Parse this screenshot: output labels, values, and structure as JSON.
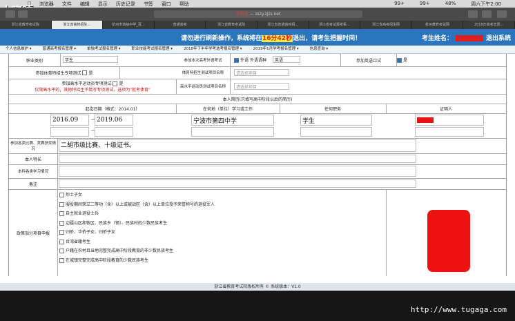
{
  "menubar": {
    "app": "浏览器",
    "items": [
      "文件",
      "编辑",
      "显示",
      "历史记录",
      "书签",
      "窗口",
      "帮助"
    ],
    "right": [
      "99+",
      "99+",
      "48%",
      "周六下午2:00"
    ]
  },
  "overlay_logo": "上嗜嘎",
  "url": {
    "red_part": "不安全",
    "text": " — zszy.zjzs.net"
  },
  "tabs": [
    "浙江省教育考试院",
    "浙江省高校招生...",
    "杭州市高级中学_百...",
    "普通高考",
    "浙江省教育考试院",
    "浙江省普通高校招...",
    "浙江省考试报考系...",
    "浙江省高考招生网",
    "杭州教育考试网",
    "2018年高考志愿..."
  ],
  "banner": {
    "prefix": "请勿进行刷新操作，系统将在",
    "timer": "16分42秒",
    "suffix": "退出，请考生把握时间！",
    "user_label": "考生姓名：",
    "logout": "退出系统"
  },
  "nav": [
    "个人信息维护 ▾",
    "普通高考报名管理 ▾",
    "单独考试报名管理 ▾",
    "职业技能考试报名管理 ▾",
    "2018年下半年学考选考报名管理 ▾",
    "2019年1月学考报名管理 ▾",
    "信息查询 ▾"
  ],
  "form": {
    "occupation_label": "职业类别",
    "occupation_value": "学生",
    "foreign_lang_label": "参加本次高考外语考试",
    "foreign_lang_value": "外语",
    "foreign_lang_subject_label": "外语语种",
    "foreign_lang_subject_value": "英语",
    "oral_label": "参加英语口试",
    "oral_value": "是",
    "sports_label": "参加体育特招生专项测试",
    "sports_value": "是",
    "sports_item_label": "体育特招生测试项目名称",
    "sports_item_placeholder": "请选择项目",
    "art_label": "参加高水平运动员专项测试",
    "art_value": "是",
    "art_note": "仅限高水平的，其他特招生不填写专项测试，选项为\"就考体育\"",
    "art_item_label": "高水平运动员测试项目名称",
    "art_item_placeholder": "请选择项目",
    "resume_title": "本人简历(只填写高中阶段以后的简历)",
    "resume_headers": [
      "起迄日期（格式：2014.01）",
      "在何地（单位）学习或工作",
      "任何职务",
      "证明人"
    ],
    "resume_rows": [
      {
        "from": "2016.09",
        "sep": "—",
        "to": "2019.06",
        "place": "宁波市第四中学",
        "role": "学生"
      },
      {
        "from": "",
        "sep": "—",
        "to": "",
        "place": "",
        "role": ""
      }
    ],
    "awards_label": "参加各类比赛、竞赛获奖情况",
    "awards_value": "二胡市级比赛、十级证书。",
    "specialty_label": "本人特长",
    "discipline_label": "本科各类学习情况",
    "remarks_label": "备注",
    "bonus_label": "政策加分项目申报",
    "bonus_options": [
      "烈士子女",
      "服役期间荣立二等功（含）以上或被战区（含）以上单位授予荣誉称号的退役军人",
      "自主就业退役士兵",
      "边疆山区和牧区、民族乡（镇）、民族村的少数民族考生",
      "归侨、华侨子女、归侨子女",
      "台湾省籍考生",
      "户籍在农村且当地完整完成高中阶段教育的非少数民族考生",
      "在城镇完整完成高中阶段教育的少数民族考生"
    ]
  },
  "footer": {
    "text": "浙江省教育考试院版权所有 © 系统版本：V1.0"
  },
  "watermark": "http://www.tugaga.com"
}
